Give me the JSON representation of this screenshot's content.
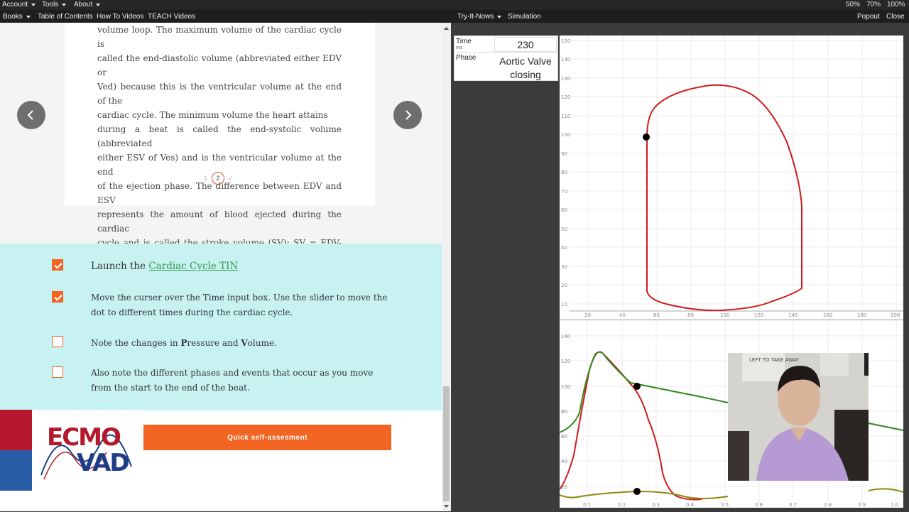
{
  "topbar": {
    "menus": [
      "Account",
      "Tools",
      "About"
    ],
    "zoom": [
      "50%",
      "70%",
      "100%"
    ]
  },
  "navbar": {
    "books": "Books",
    "toc": "Table of Contents",
    "howto": "How To Videos",
    "teach": "TEACH Videos",
    "tryit": "Try-It-Nows",
    "simulation": "Simulation",
    "popout": "Popout",
    "close": "Close"
  },
  "reading": {
    "lines": [
      "volume loop. The maximum volume of the cardiac cycle is",
      "called the end-diastolic volume (abbreviated either EDV or",
      "Ved) because this is the ventricular volume at the end of the",
      "cardiac cycle. The minimum volume the heart attains",
      "during a beat is called the end-systolic volume (abbreviated",
      "either ESV of Ves) and is the ventricular volume at the end",
      "of the ejection phase. The difference between EDV and ESV",
      "represents the amount of blood ejected during the cardiac",
      "cycle and is called the stroke volume (SV): SV = EDV-ESV."
    ],
    "pager": {
      "prev_page": "1",
      "current_page": "2",
      "done": "✓"
    }
  },
  "tasks": [
    {
      "prefix": "Launch the ",
      "link": "Cardiac Cycle TIN",
      "checked": true
    },
    {
      "text": "Move the curser over the Time input box.  Use the slider to move the dot to different times during the cardiac cycle.",
      "checked": true
    },
    {
      "text_a": "Note the changes in ",
      "bold_p": "P",
      "text_b": "ressure and ",
      "bold_v": "V",
      "text_c": "olume.",
      "checked": false
    },
    {
      "text": "Also note the different phases and events that occur as you move from the start to the end of the beat.",
      "checked": false
    }
  ],
  "quick_button": "Quick self-assesment",
  "logo": {
    "top": "ECMO",
    "bottom": "VAD"
  },
  "sim": {
    "time_label": "Time",
    "time_unit": "ms",
    "time_value": "230",
    "phase_label": "Phase",
    "phase_value_1": "Aortic Valve",
    "phase_value_2": "closing"
  },
  "pv_loop": {
    "y_ticks": [
      "150",
      "140",
      "130",
      "120",
      "110",
      "100",
      "90",
      "80",
      "70",
      "60",
      "50",
      "40",
      "30",
      "20",
      "10"
    ],
    "x_ticks": [
      "20",
      "40",
      "60",
      "80",
      "100",
      "120",
      "140",
      "160",
      "180",
      "200"
    ],
    "current_point": {
      "volume": 66,
      "pressure": 100
    },
    "color": "#d11a1a"
  },
  "pressure_time": {
    "y_ticks": [
      "140",
      "120",
      "100",
      "80",
      "60",
      "40",
      "20"
    ],
    "x_ticks": [
      "0.1",
      "0.2",
      "0.3",
      "0.4",
      "0.5",
      "0.6",
      "0.7",
      "0.8",
      "0.9",
      "1.0"
    ],
    "current_time": "0.23",
    "series_colors": {
      "lv": "#d11a1a",
      "aorta": "#2f8a1e",
      "atrium": "#8a8a10"
    }
  },
  "video": {
    "sign": "LEFT TO TAKE AWAY"
  },
  "colors": {
    "accent": "#f26522",
    "teal": "#c8f2f2",
    "link": "#2e9a4a"
  }
}
